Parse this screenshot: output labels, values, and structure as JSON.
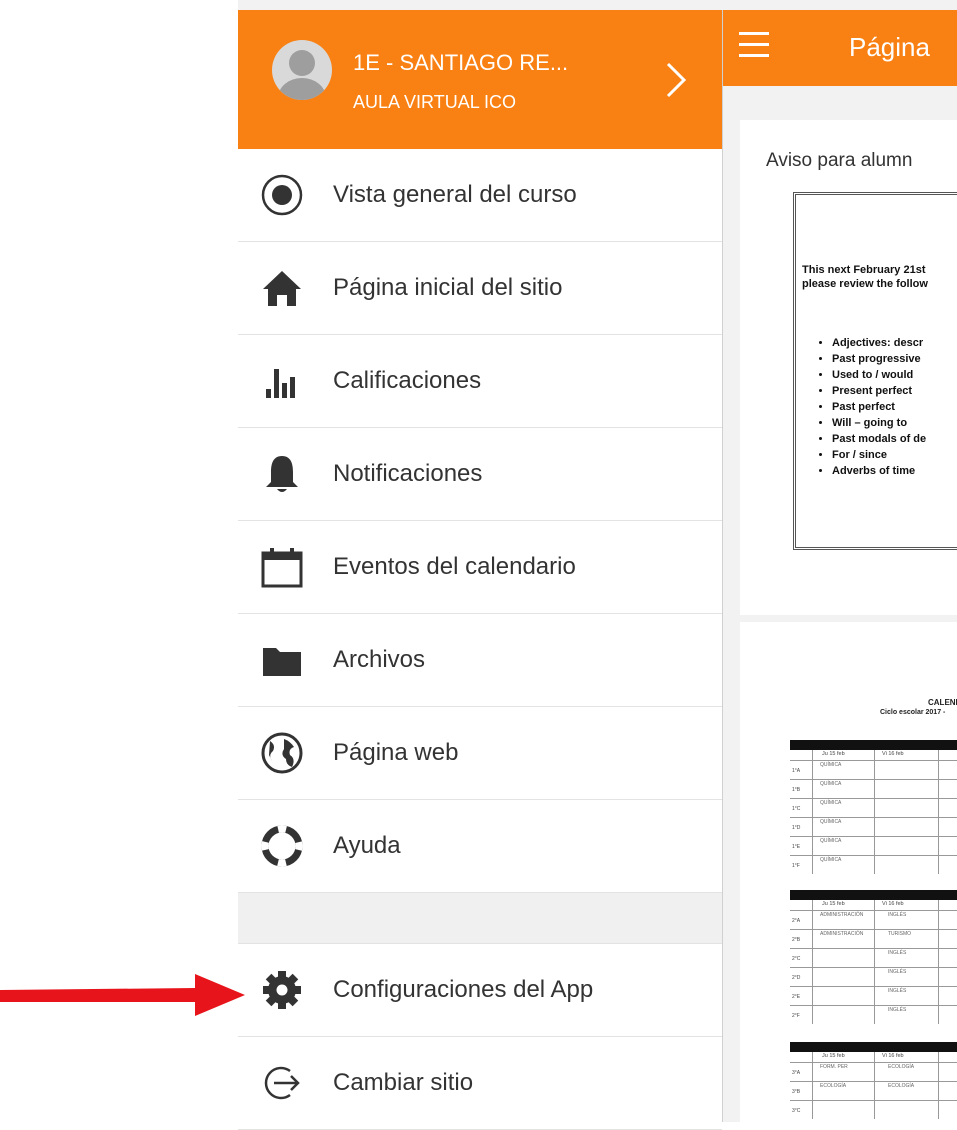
{
  "sidebar": {
    "user_name": "1E - SANTIAGO RE...",
    "site_name": "AULA VIRTUAL ICO",
    "items": [
      {
        "label": "Vista general del curso",
        "icon": "course-overview-icon"
      },
      {
        "label": "Página inicial del sitio",
        "icon": "home-icon"
      },
      {
        "label": "Calificaciones",
        "icon": "grades-chart-icon"
      },
      {
        "label": "Notificaciones",
        "icon": "bell-icon"
      },
      {
        "label": "Eventos del calendario",
        "icon": "calendar-icon"
      },
      {
        "label": "Archivos",
        "icon": "folder-icon"
      },
      {
        "label": "Página web",
        "icon": "globe-icon"
      },
      {
        "label": "Ayuda",
        "icon": "lifebuoy-icon"
      },
      {
        "label": "Configuraciones del App",
        "icon": "gear-icon"
      },
      {
        "label": "Cambiar sitio",
        "icon": "switch-site-icon"
      }
    ]
  },
  "topbar": {
    "title": "Página"
  },
  "main": {
    "notice_label": "Aviso para alumn",
    "doc": {
      "intro_line1": "This next February 21st",
      "intro_line2": "please review the follow",
      "topics": [
        "Adjectives: descr",
        "Past progressive",
        "Used to / would",
        "Present perfect",
        "Past perfect",
        "Will – going to",
        "Past modals of de",
        "For / since",
        "Adverbs of time"
      ]
    },
    "calendar": {
      "title": "CALENDA",
      "subtitle": "Ciclo escolar 2017 -",
      "col1": "Ju 15 feb",
      "col2": "Vi 16 feb",
      "block1_rows": [
        "1°A",
        "1°B",
        "1°C",
        "1°D",
        "1°E",
        "1°F"
      ],
      "block1_cells": [
        "QUÍMICA",
        "QUÍMICA",
        "QUÍMICA",
        "QUÍMICA",
        "QUÍMICA",
        "QUÍMICA"
      ],
      "block2_rows": [
        "2°A",
        "2°B",
        "2°C",
        "2°D",
        "2°E",
        "2°F"
      ],
      "block2_col2": [
        "INGLÉS",
        "TURISMO",
        "INGLÉS",
        "INGLÉS",
        "INGLÉS",
        "INGLÉS",
        "INGLÉS"
      ],
      "block2_col1": [
        "ADMINISTRACIÓN",
        "ADMINISTRACIÓN"
      ],
      "block3_rows": [
        "3°A",
        "3°B",
        "3°C"
      ],
      "block3_col2": [
        "ECOLOGÍA",
        "ECOLOGÍA"
      ],
      "block3_col1": [
        "FORM. PER",
        "ECOLOGÍA"
      ]
    }
  },
  "colors": {
    "accent": "#f98012",
    "arrow": "#e8141b"
  }
}
